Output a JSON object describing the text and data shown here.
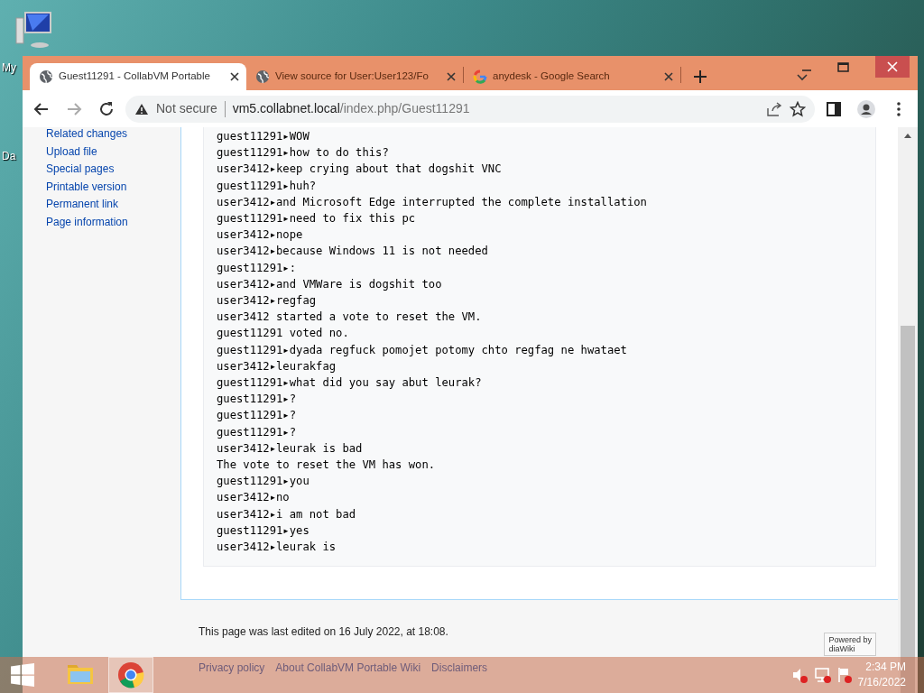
{
  "desktop_icons": [
    {
      "label": "My"
    }
  ],
  "desktop_cut_labels": [
    "Da"
  ],
  "browser": {
    "tabs": [
      {
        "title": "Guest11291 - CollabVM Portable",
        "kind": "globe",
        "selected": true
      },
      {
        "title": "View source for User:User123/Fo",
        "kind": "globe",
        "selected": false
      },
      {
        "title": "anydesk - Google Search",
        "kind": "google",
        "selected": false
      }
    ],
    "security": "Not secure",
    "url_host": "vm5.collabnet.local",
    "url_path": "/index.php/Guest11291"
  },
  "sidebar": {
    "links": [
      "Related changes",
      "Upload file",
      "Special pages",
      "Printable version",
      "Permanent link",
      "Page information"
    ]
  },
  "chat_lines": [
    "guest11291▸WOW",
    "guest11291▸how to do this?",
    "user3412▸keep crying about that dogshit VNC",
    "guest11291▸huh?",
    "user3412▸and Microsoft Edge interrupted the complete installation",
    "guest11291▸need to fix this pc",
    "user3412▸nope",
    "user3412▸because Windows 11 is not needed",
    "guest11291▸:",
    "user3412▸and VMWare is dogshit too",
    "user3412▸regfag",
    "user3412 started a vote to reset the VM.",
    "guest11291 voted no.",
    "guest11291▸dyada regfuck pomojet potomy chto regfag ne hwataet",
    "user3412▸leurakfag",
    "guest11291▸what did you say abut leurak?",
    "guest11291▸?",
    "guest11291▸?",
    "guest11291▸?",
    "user3412▸leurak is bad",
    "The vote to reset the VM has won.",
    "guest11291▸you",
    "user3412▸no",
    "user3412▸i am not bad",
    "guest11291▸yes",
    "user3412▸leurak is"
  ],
  "footer": {
    "last_edited": "This page was last edited on 16 July 2022, at 18:08.",
    "links": [
      "Privacy policy",
      "About CollabVM Portable Wiki",
      "Disclaimers"
    ],
    "badge": [
      "Powered by",
      "diaWiki"
    ]
  },
  "taskbar": {
    "apps": [
      {
        "kind": "explorer",
        "selected": false
      },
      {
        "kind": "chrome",
        "selected": true
      }
    ],
    "time": "2:34 PM",
    "date": "7/16/2022"
  }
}
